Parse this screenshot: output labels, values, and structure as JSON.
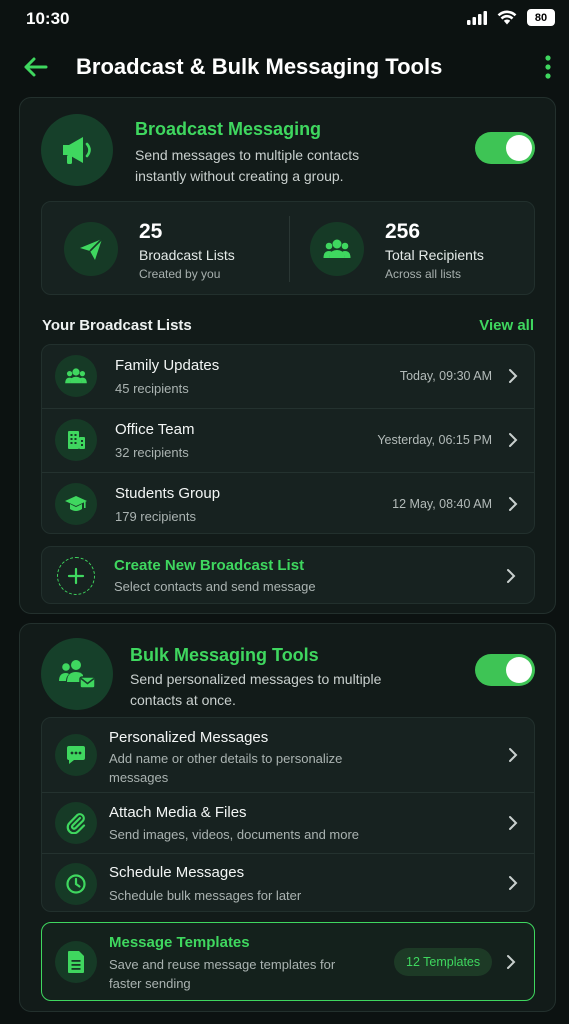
{
  "status_bar": {
    "time": "10:30",
    "battery": "80"
  },
  "header": {
    "title": "Broadcast & Bulk Messaging Tools"
  },
  "broadcast": {
    "title": "Broadcast Messaging",
    "description": "Send messages to multiple contacts instantly without creating a group.",
    "enabled": true,
    "stats": [
      {
        "value": "25",
        "label": "Broadcast Lists",
        "sub": "Created by you",
        "icon": "paper-plane-icon"
      },
      {
        "value": "256",
        "label": "Total Recipients",
        "sub": "Across all lists",
        "icon": "group-icon"
      }
    ],
    "lists_heading": "Your Broadcast Lists",
    "view_all": "View all",
    "lists": [
      {
        "name": "Family Updates",
        "recipients": "45 recipients",
        "time": "Today, 09:30 AM",
        "icon": "family-icon"
      },
      {
        "name": "Office Team",
        "recipients": "32 recipients",
        "time": "Yesterday, 06:15 PM",
        "icon": "office-building-icon"
      },
      {
        "name": "Students Group",
        "recipients": "179 recipients",
        "time": "12 May, 08:40 AM",
        "icon": "graduation-cap-icon"
      }
    ],
    "create": {
      "title": "Create New Broadcast List",
      "sub": "Select contacts and send message"
    }
  },
  "bulk": {
    "title": "Bulk Messaging Tools",
    "description": "Send personalized messages to multiple contacts at once.",
    "enabled": true,
    "tools": [
      {
        "title": "Personalized Messages",
        "sub": "Add name or other details to personalize messages",
        "icon": "chat-bubble-icon"
      },
      {
        "title": "Attach Media & Files",
        "sub": "Send images, videos, documents and more",
        "icon": "paperclip-icon"
      },
      {
        "title": "Schedule Messages",
        "sub": "Schedule bulk messages for later",
        "icon": "clock-icon"
      }
    ],
    "templates": {
      "title": "Message Templates",
      "sub": "Save and reuse message templates for faster sending",
      "badge": "12 Templates",
      "icon": "document-icon"
    }
  },
  "colors": {
    "accent": "#3fd75f",
    "background": "#0c1211",
    "card": "#121b19"
  }
}
